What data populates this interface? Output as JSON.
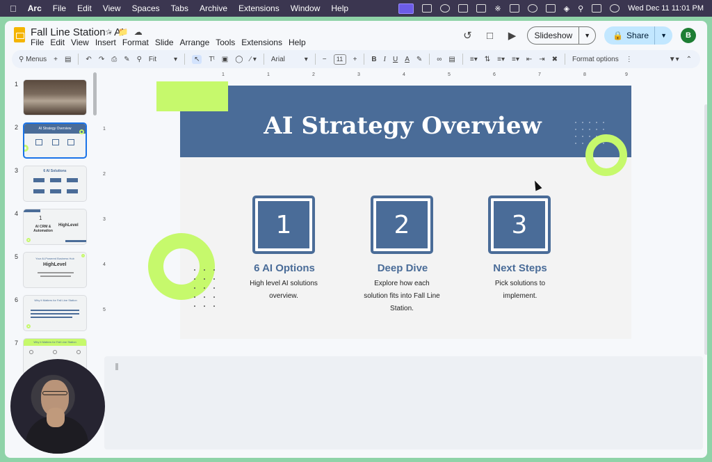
{
  "macos": {
    "app": "Arc",
    "menus": [
      "File",
      "Edit",
      "View",
      "Spaces",
      "Tabs",
      "Archive",
      "Extensions",
      "Window",
      "Help"
    ],
    "clock": "Wed Dec 11  11:01 PM"
  },
  "doc": {
    "title": "Fall Line Station - AI",
    "menus": [
      "File",
      "Edit",
      "View",
      "Insert",
      "Format",
      "Slide",
      "Arrange",
      "Tools",
      "Extensions",
      "Help"
    ],
    "slideshow_label": "Slideshow",
    "share_label": "Share",
    "avatar_initial": "B"
  },
  "toolbar": {
    "menus_label": "Menus",
    "zoom": "Fit",
    "font": "Arial",
    "font_size": "11",
    "format_options": "Format options"
  },
  "ruler": {
    "h": [
      "1",
      "1",
      "2",
      "3",
      "4",
      "5",
      "6",
      "7",
      "8",
      "9"
    ],
    "v": [
      "1",
      "2",
      "3",
      "4",
      "5"
    ]
  },
  "filmstrip": {
    "numbers": [
      "1",
      "2",
      "3",
      "4",
      "5",
      "6",
      "7"
    ],
    "t2_title": "AI Strategy Overview",
    "t3_title": "6 AI Solutions",
    "t4_num": "1",
    "t4_text": "AI CRM & Automation",
    "t4_brand": "HighLevel",
    "t5_text": "Your AI-Powered Business Hub",
    "t5_brand": "HighLevel",
    "t6_title": "Why It Matters for Fall Line Station",
    "t7_title": "Why It Matters for Fall Line Station"
  },
  "slide": {
    "title": "AI Strategy Overview",
    "columns": [
      {
        "number": "1",
        "title": "6 AI Options",
        "desc": "High level AI solutions overview."
      },
      {
        "number": "2",
        "title": "Deep Dive",
        "desc": "Explore how each solution fits into Fall Line Station."
      },
      {
        "number": "3",
        "title": "Next Steps",
        "desc": "Pick solutions to implement."
      }
    ]
  },
  "colors": {
    "header_blue": "#4a6c98",
    "accent_green": "#c6f96c"
  }
}
